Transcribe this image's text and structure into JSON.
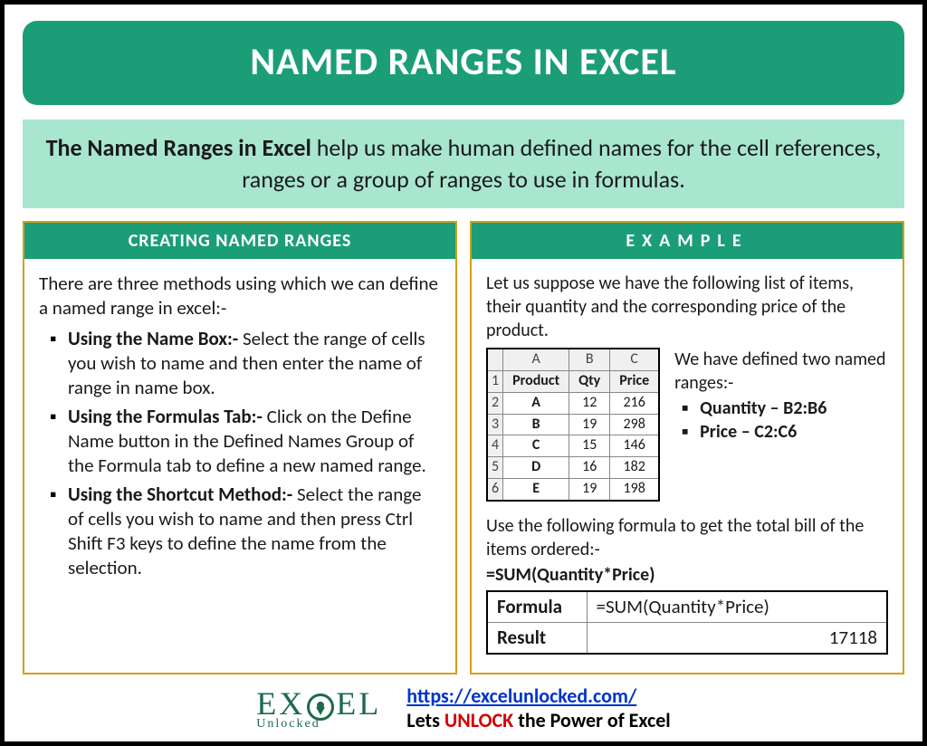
{
  "title": "NAMED RANGES IN EXCEL",
  "intro_bold": "The Named Ranges in Excel",
  "intro_rest": " help us make human defined names for the cell references, ranges or a group of ranges to use in formulas.",
  "left": {
    "header": "CREATING NAMED RANGES",
    "lead": "There are three methods using which we can define a named range in excel:-",
    "methods": [
      {
        "title": "Using the Name Box:-",
        "desc": " Select the range of cells you wish to name and then enter the name of range in name box."
      },
      {
        "title": "Using the Formulas Tab:-",
        "desc": " Click on the Define Name button in the Defined Names Group of the Formula tab to define a new named range."
      },
      {
        "title": "Using the Shortcut Method:-",
        "desc": " Select the range of cells you wish to name and then press Ctrl Shift F3 keys to define the name from the selection."
      }
    ]
  },
  "right": {
    "header": "EXAMPLE",
    "lead": "Let us suppose we have the following list of items, their quantity and the corresponding price of the product.",
    "table": {
      "cols": [
        "A",
        "B",
        "C"
      ],
      "headers": [
        "Product",
        "Qty",
        "Price"
      ],
      "rows": [
        {
          "n": "2",
          "p": "A",
          "q": "12",
          "pr": "216"
        },
        {
          "n": "3",
          "p": "B",
          "q": "19",
          "pr": "298"
        },
        {
          "n": "4",
          "p": "C",
          "q": "15",
          "pr": "146"
        },
        {
          "n": "5",
          "p": "D",
          "q": "16",
          "pr": "182"
        },
        {
          "n": "6",
          "p": "E",
          "q": "19",
          "pr": "198"
        }
      ]
    },
    "ranges_intro": "We have defined two named ranges:-",
    "ranges": [
      "Quantity – B2:B6",
      "Price – C2:C6"
    ],
    "formula_intro": "Use the following formula to get the total bill of the items ordered:-",
    "formula": "=SUM(Quantity*Price)",
    "result_table": {
      "formula_label": "Formula",
      "formula_value": "=SUM(Quantity*Price)",
      "result_label": "Result",
      "result_value": "17118"
    }
  },
  "footer": {
    "logo_main": "EX   EL",
    "logo_sub": "Unlocked",
    "url": "https://excelunlocked.com/",
    "tag_pre": "Lets ",
    "tag_mid": "UNLOCK",
    "tag_post": " the Power of Excel"
  },
  "chart_data": {
    "type": "table",
    "title": "Product Quantity and Price",
    "columns": [
      "Product",
      "Qty",
      "Price"
    ],
    "rows": [
      [
        "A",
        12,
        216
      ],
      [
        "B",
        19,
        298
      ],
      [
        "C",
        15,
        146
      ],
      [
        "D",
        16,
        182
      ],
      [
        "E",
        19,
        198
      ]
    ],
    "named_ranges": {
      "Quantity": "B2:B6",
      "Price": "C2:C6"
    },
    "formula": "=SUM(Quantity*Price)",
    "result": 17118
  }
}
